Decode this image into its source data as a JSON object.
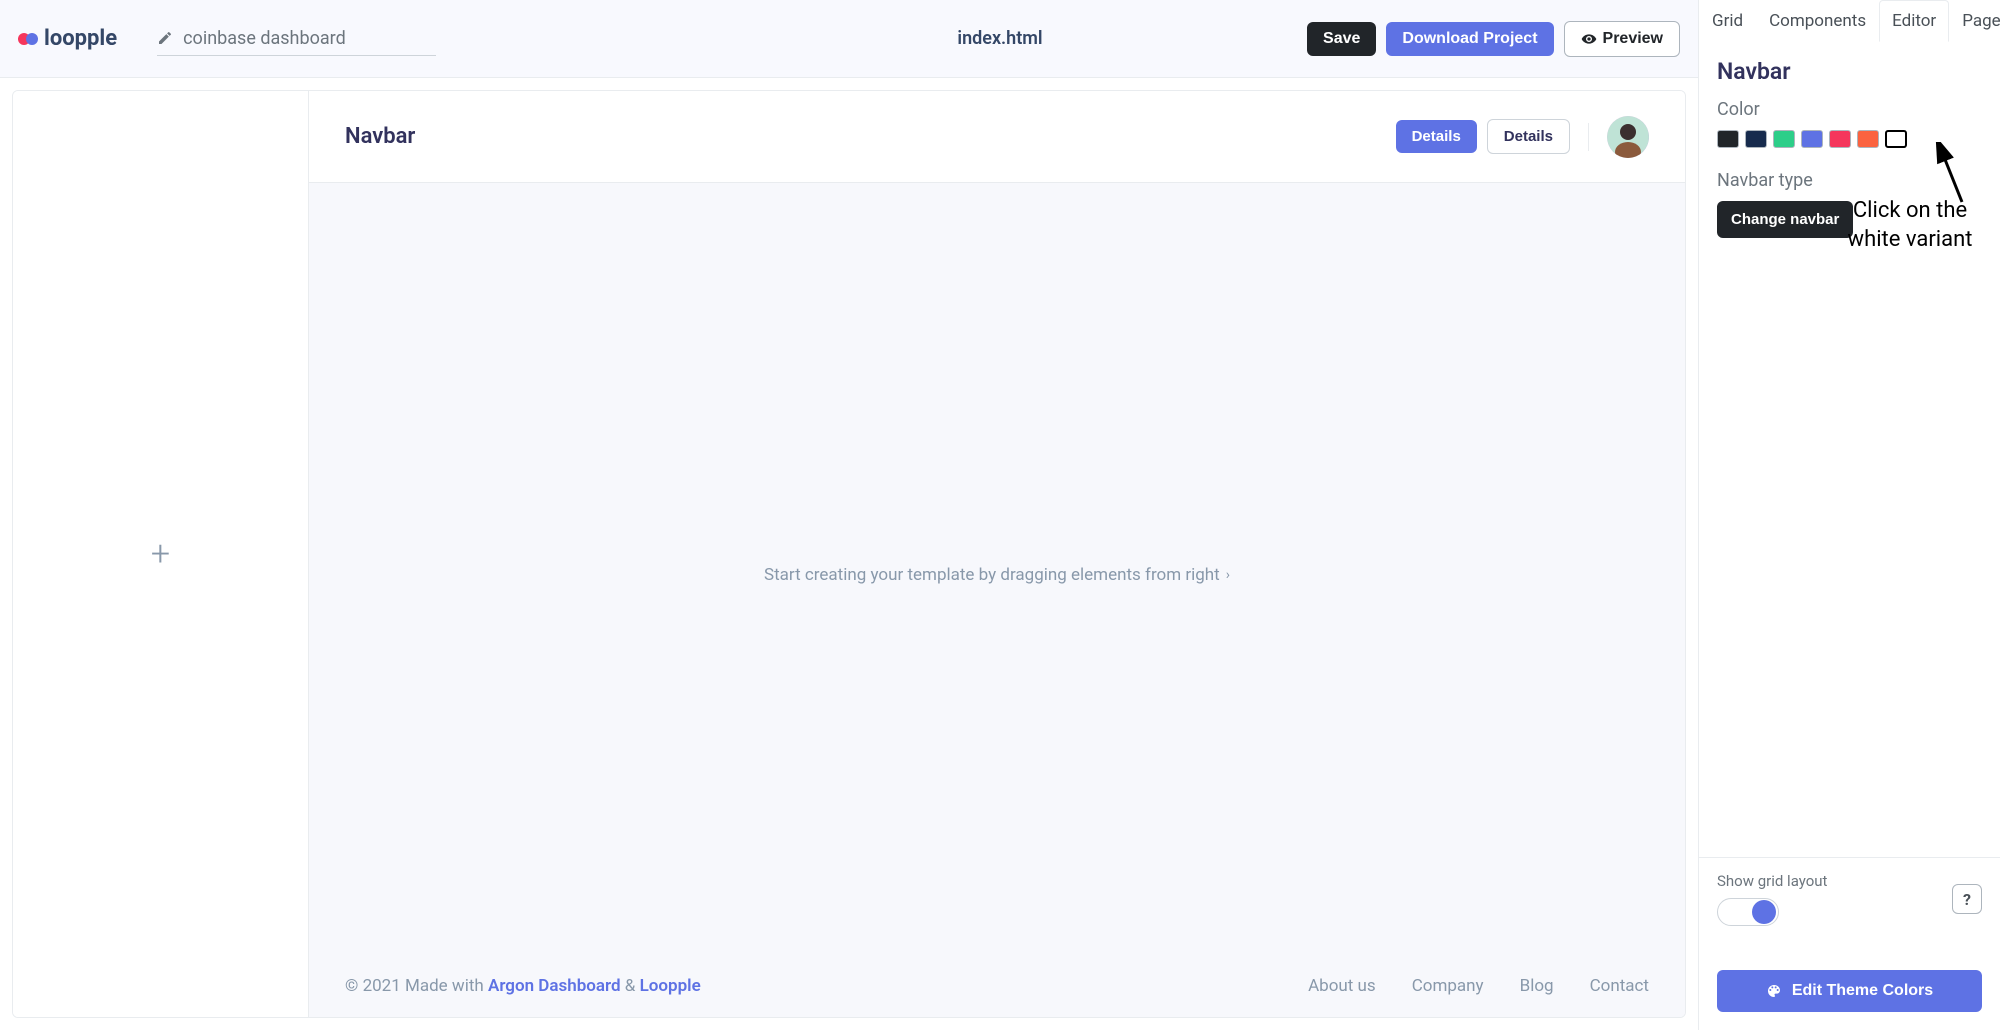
{
  "header": {
    "logo_text": "loopple",
    "project_name": "coinbase dashboard",
    "file_name": "index.html",
    "save_label": "Save",
    "download_label": "Download Project",
    "preview_label": "Preview"
  },
  "canvas": {
    "navbar_title": "Navbar",
    "details_primary": "Details",
    "details_secondary": "Details",
    "empty_message": "Start creating your template by dragging elements from right",
    "footer": {
      "copyright_prefix": "© 2021 Made with ",
      "link1": "Argon Dashboard",
      "separator": " & ",
      "link2": "Loopple",
      "about": "About us",
      "company": "Company",
      "blog": "Blog",
      "contact": "Contact"
    }
  },
  "right_panel": {
    "tabs": {
      "grid": "Grid",
      "components": "Components",
      "editor": "Editor",
      "pages": "Pages"
    },
    "section_title": "Navbar",
    "color_label": "Color",
    "colors": [
      "#212529",
      "#172b4d",
      "#2dce89",
      "#5e72e4",
      "#f5365c",
      "#fb6340",
      "#ffffff"
    ],
    "navbar_type_label": "Navbar type",
    "change_navbar_label": "Change navbar",
    "grid_toggle_label": "Show grid layout",
    "help_label": "?",
    "edit_theme_label": "Edit Theme Colors"
  },
  "annotation": {
    "line1": "Click on the",
    "line2": "white variant"
  }
}
